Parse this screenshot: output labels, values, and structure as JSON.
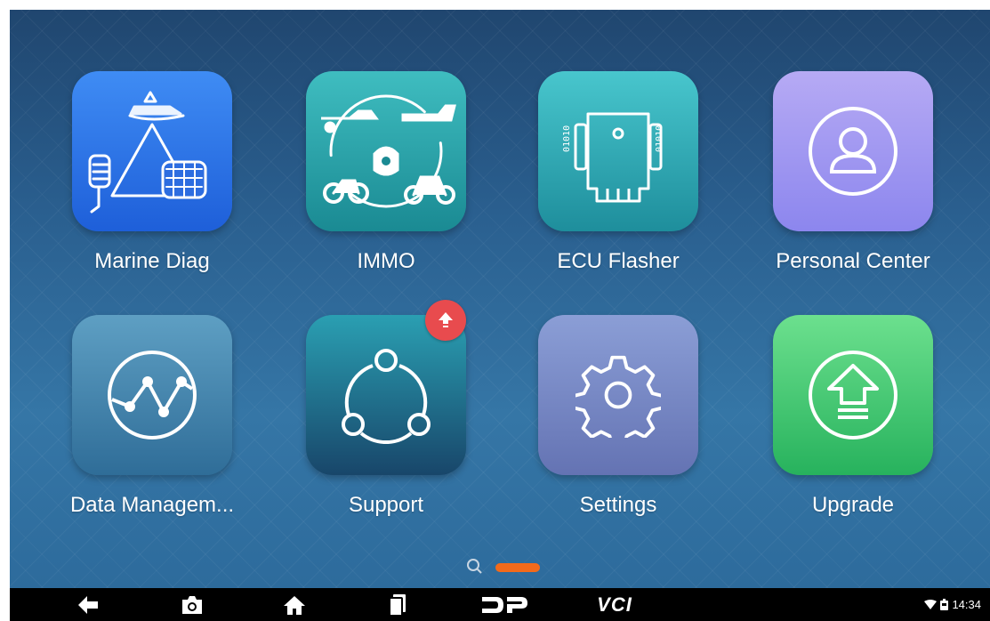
{
  "apps": [
    {
      "id": "marine",
      "label": "Marine Diag",
      "icon": "marine-vehicles-icon"
    },
    {
      "id": "immo",
      "label": "IMMO",
      "icon": "immobilizer-key-icon"
    },
    {
      "id": "ecu",
      "label": "ECU Flasher",
      "icon": "ecu-chip-icon"
    },
    {
      "id": "person",
      "label": "Personal Center",
      "icon": "user-profile-icon"
    },
    {
      "id": "data",
      "label": "Data Managem...",
      "icon": "line-graph-icon"
    },
    {
      "id": "support",
      "label": "Support",
      "icon": "share-network-icon",
      "badge": "update-available-badge"
    },
    {
      "id": "settings",
      "label": "Settings",
      "icon": "gear-icon"
    },
    {
      "id": "upgrade",
      "label": "Upgrade",
      "icon": "upgrade-arrow-icon"
    }
  ],
  "pager": {
    "pages": 2,
    "current": 1
  },
  "navbar": {
    "buttons": [
      "back-icon",
      "camera-icon",
      "home-icon",
      "recent-apps-icon",
      "dp-logo-icon"
    ],
    "vci_label": "VCI"
  },
  "status": {
    "time": "14:34",
    "icons": [
      "wifi-icon",
      "battery-icon"
    ]
  },
  "colors": {
    "accent": "#f26a1b",
    "badge": "#e84b4e",
    "navbar": "#000000"
  }
}
